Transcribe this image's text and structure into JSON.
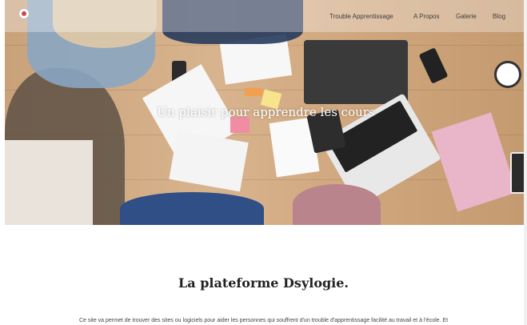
{
  "nav": {
    "items": [
      {
        "label": "Trouble Apprentissage"
      },
      {
        "label": "A Propos"
      },
      {
        "label": "Galerie"
      },
      {
        "label": "Blog"
      }
    ]
  },
  "hero": {
    "title": "Un plaisir pour apprendre les cours"
  },
  "main": {
    "title": "La plateforme Dsylogie.",
    "intro": "Ce site va permet de trouver des sites ou logiciels pour aider les personnes qui souffrent d'un trouble d'apprentissage facilité au travail et à l'école. Et"
  },
  "colors": {
    "accent": "#d04848",
    "text_dark": "#222222"
  }
}
